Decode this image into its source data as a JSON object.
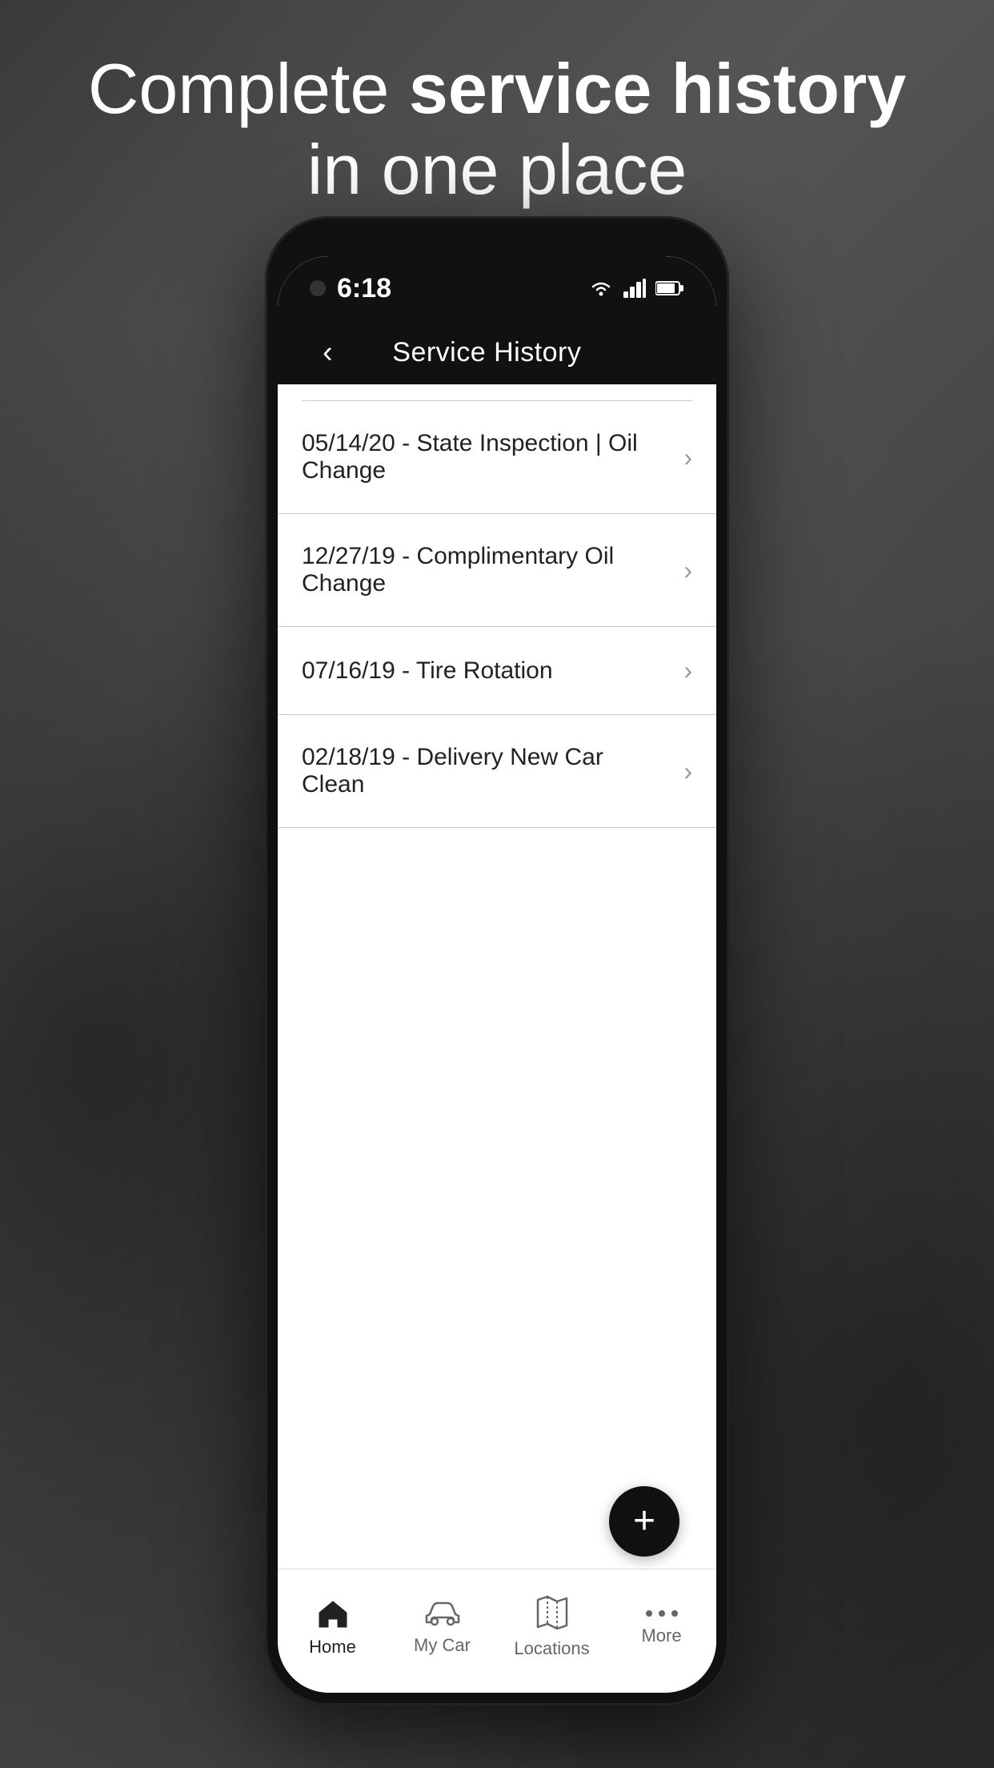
{
  "background": {
    "headline": {
      "part1": "Complete ",
      "part2_bold": "service history",
      "part3": " in one place"
    }
  },
  "status_bar": {
    "time": "6:18",
    "wifi": "▼",
    "battery": ""
  },
  "nav": {
    "back_label": "‹",
    "title": "Service History"
  },
  "service_items": [
    {
      "label": "05/14/20 - State Inspection | Oil Change"
    },
    {
      "label": "12/27/19 - Complimentary Oil Change"
    },
    {
      "label": "07/16/19 - Tire Rotation"
    },
    {
      "label": "02/18/19 - Delivery New Car Clean"
    }
  ],
  "fab": {
    "label": "+"
  },
  "bottom_tabs": [
    {
      "id": "home",
      "label": "Home",
      "icon": "⌂",
      "active": true
    },
    {
      "id": "my-car",
      "label": "My Car",
      "icon": "🚗",
      "active": false
    },
    {
      "id": "locations",
      "label": "Locations",
      "icon": "🗺",
      "active": false
    },
    {
      "id": "more",
      "label": "More",
      "icon": "•••",
      "active": false
    }
  ]
}
